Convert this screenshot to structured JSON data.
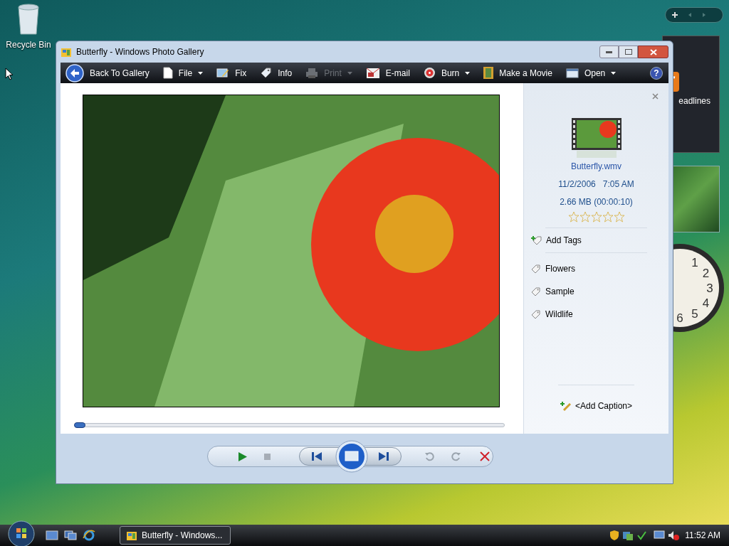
{
  "desktop": {
    "icons": [
      {
        "label": "Recycle Bin"
      }
    ]
  },
  "gadgets": {
    "headlines": {
      "label": "eadlines"
    },
    "clock": {
      "numerals": [
        "1",
        "2",
        "3",
        "4",
        "5",
        "6"
      ]
    }
  },
  "window": {
    "title": "Butterfly - Windows Photo Gallery"
  },
  "toolbar": [
    {
      "kind": "back",
      "label": "Back To Gallery",
      "dropdown": false,
      "disabled": false
    },
    {
      "kind": "file",
      "label": "File",
      "dropdown": true,
      "disabled": false
    },
    {
      "kind": "fix",
      "label": "Fix",
      "dropdown": false,
      "disabled": false
    },
    {
      "kind": "info",
      "label": "Info",
      "dropdown": false,
      "disabled": false
    },
    {
      "kind": "print",
      "label": "Print",
      "dropdown": true,
      "disabled": true
    },
    {
      "kind": "email",
      "label": "E-mail",
      "dropdown": false,
      "disabled": false
    },
    {
      "kind": "burn",
      "label": "Burn",
      "dropdown": true,
      "disabled": false
    },
    {
      "kind": "movie",
      "label": "Make a Movie",
      "dropdown": false,
      "disabled": false
    },
    {
      "kind": "open",
      "label": "Open",
      "dropdown": true,
      "disabled": false
    }
  ],
  "help": {
    "label": "?"
  },
  "seek": {
    "level": 0.01
  },
  "info_pane": {
    "file_name": "Butterfly.wmv",
    "date": "11/2/2006   7:05 AM",
    "size": "2.66 MB (00:00:10)",
    "stars": 0,
    "add_tags": "Add Tags",
    "tags": [
      {
        "label": "Flowers"
      },
      {
        "label": "Sample"
      },
      {
        "label": "Wildlife"
      }
    ],
    "caption": "<Add Caption>"
  },
  "taskbar": {
    "buttons": [
      {
        "label": "Butterfly - Windows...",
        "selected": true
      }
    ],
    "clock": "11:52 AM"
  }
}
